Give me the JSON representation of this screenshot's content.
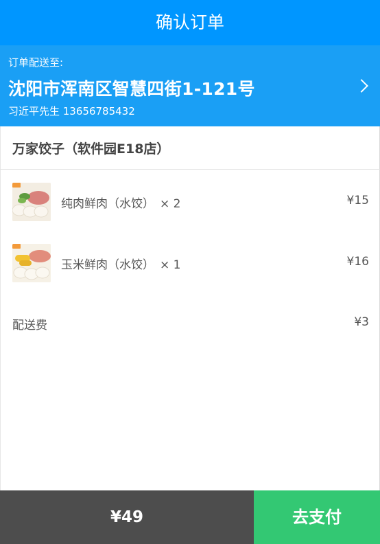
{
  "header": {
    "title": "确认订单"
  },
  "address": {
    "label": "订单配送至:",
    "line": "沈阳市浑南区智慧四街1-121号",
    "contact": "习近平先生 13656785432"
  },
  "shop": {
    "name": "万家饺子（软件园E18店）"
  },
  "items": [
    {
      "name": "纯肉鲜肉（水饺）",
      "qty": "× 2",
      "price": "¥15"
    },
    {
      "name": "玉米鲜肉（水饺）",
      "qty": "× 1",
      "price": "¥16"
    }
  ],
  "delivery": {
    "label": "配送费",
    "value": "¥3"
  },
  "footer": {
    "total": "¥49",
    "pay_label": "去支付"
  },
  "colors": {
    "header": "#0096ff",
    "address": "#1a9ff5",
    "total_bg": "#4d4d4d",
    "pay_bg": "#33c873"
  }
}
